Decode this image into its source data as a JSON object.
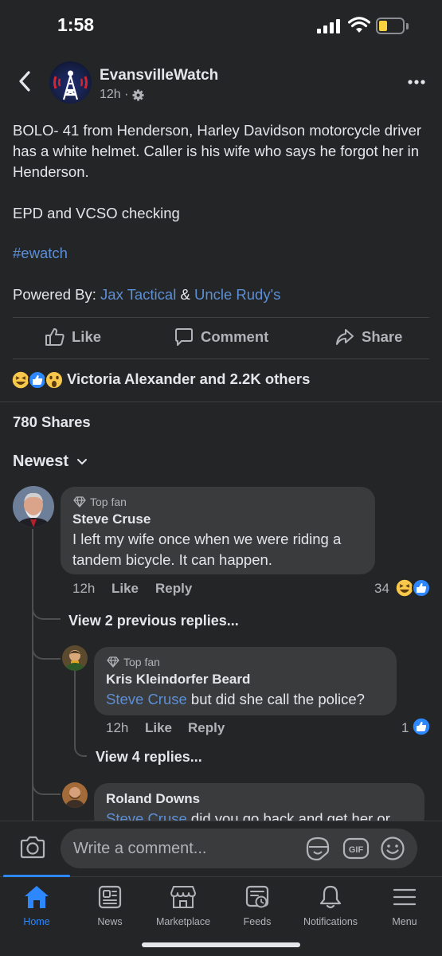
{
  "status_bar": {
    "time": "1:58"
  },
  "header": {
    "page_name": "EvansvilleWatch",
    "post_age": "12h ·"
  },
  "post": {
    "text_para1": "BOLO- 41 from Henderson, Harley Davidson motorcycle driver has a white helmet. Caller is his wife who says he forgot her in Henderson.",
    "text_para2": "EPD and VCSO checking",
    "hashtag": "#ewatch",
    "powered_prefix": "Powered By: ",
    "sponsor1": "Jax Tactical",
    "amp": " & ",
    "sponsor2": "Uncle Rudy's"
  },
  "actions": {
    "like": "Like",
    "comment": "Comment",
    "share": "Share"
  },
  "reactions": {
    "summary": "Victoria Alexander and 2.2K others"
  },
  "shares": {
    "label": "780 Shares"
  },
  "sort": {
    "label": "Newest"
  },
  "comments": [
    {
      "badge": "Top fan",
      "name": "Steve Cruse",
      "text": "I left my wife once when we were riding a tandem bicycle.  It can happen.",
      "time": "12h",
      "like": "Like",
      "reply": "Reply",
      "reaction_count": "34",
      "view_previous": "View 2 previous replies..."
    },
    {
      "badge": "Top fan",
      "name": "Kris Kleindorfer Beard",
      "mention": "Steve Cruse",
      "text": " but did she call the police?",
      "time": "12h",
      "like": "Like",
      "reply": "Reply",
      "reaction_count": "1",
      "view_replies": "View 4 replies..."
    },
    {
      "name": "Roland Downs",
      "mention": "Steve Cruse",
      "text": " did you go back and get her or"
    }
  ],
  "composer": {
    "placeholder": "Write a comment..."
  },
  "nav": [
    {
      "label": "Home",
      "icon": "home-icon"
    },
    {
      "label": "News",
      "icon": "news-icon"
    },
    {
      "label": "Marketplace",
      "icon": "marketplace-icon"
    },
    {
      "label": "Feeds",
      "icon": "feeds-icon"
    },
    {
      "label": "Notifications",
      "icon": "bell-icon"
    },
    {
      "label": "Menu",
      "icon": "menu-icon"
    }
  ],
  "colors": {
    "accent": "#2d88ff",
    "link": "#5c8fd6",
    "background": "#242526",
    "bubble": "#3a3b3c"
  }
}
